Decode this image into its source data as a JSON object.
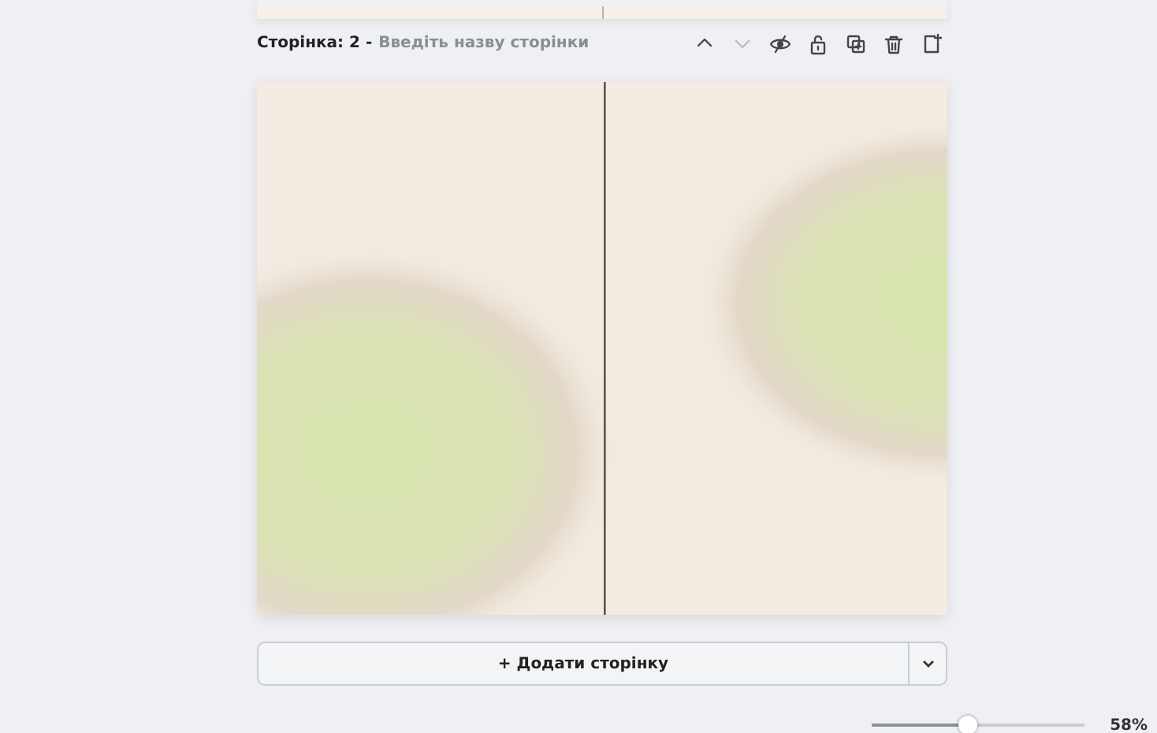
{
  "page_header": {
    "label": "Сторінка: 2 -",
    "title_placeholder": "Введіть назву сторінки"
  },
  "page_tools": [
    {
      "kind": "up",
      "disabled": false
    },
    {
      "kind": "down",
      "disabled": true
    },
    {
      "kind": "hide",
      "disabled": false
    },
    {
      "kind": "lock",
      "disabled": false
    },
    {
      "kind": "duplicate",
      "disabled": false
    },
    {
      "kind": "delete",
      "disabled": false
    },
    {
      "kind": "add",
      "disabled": false
    }
  ],
  "add_page_button": {
    "label": "+ Додати сторінку"
  },
  "zoom": {
    "level": 0.45,
    "reading": "58%"
  }
}
